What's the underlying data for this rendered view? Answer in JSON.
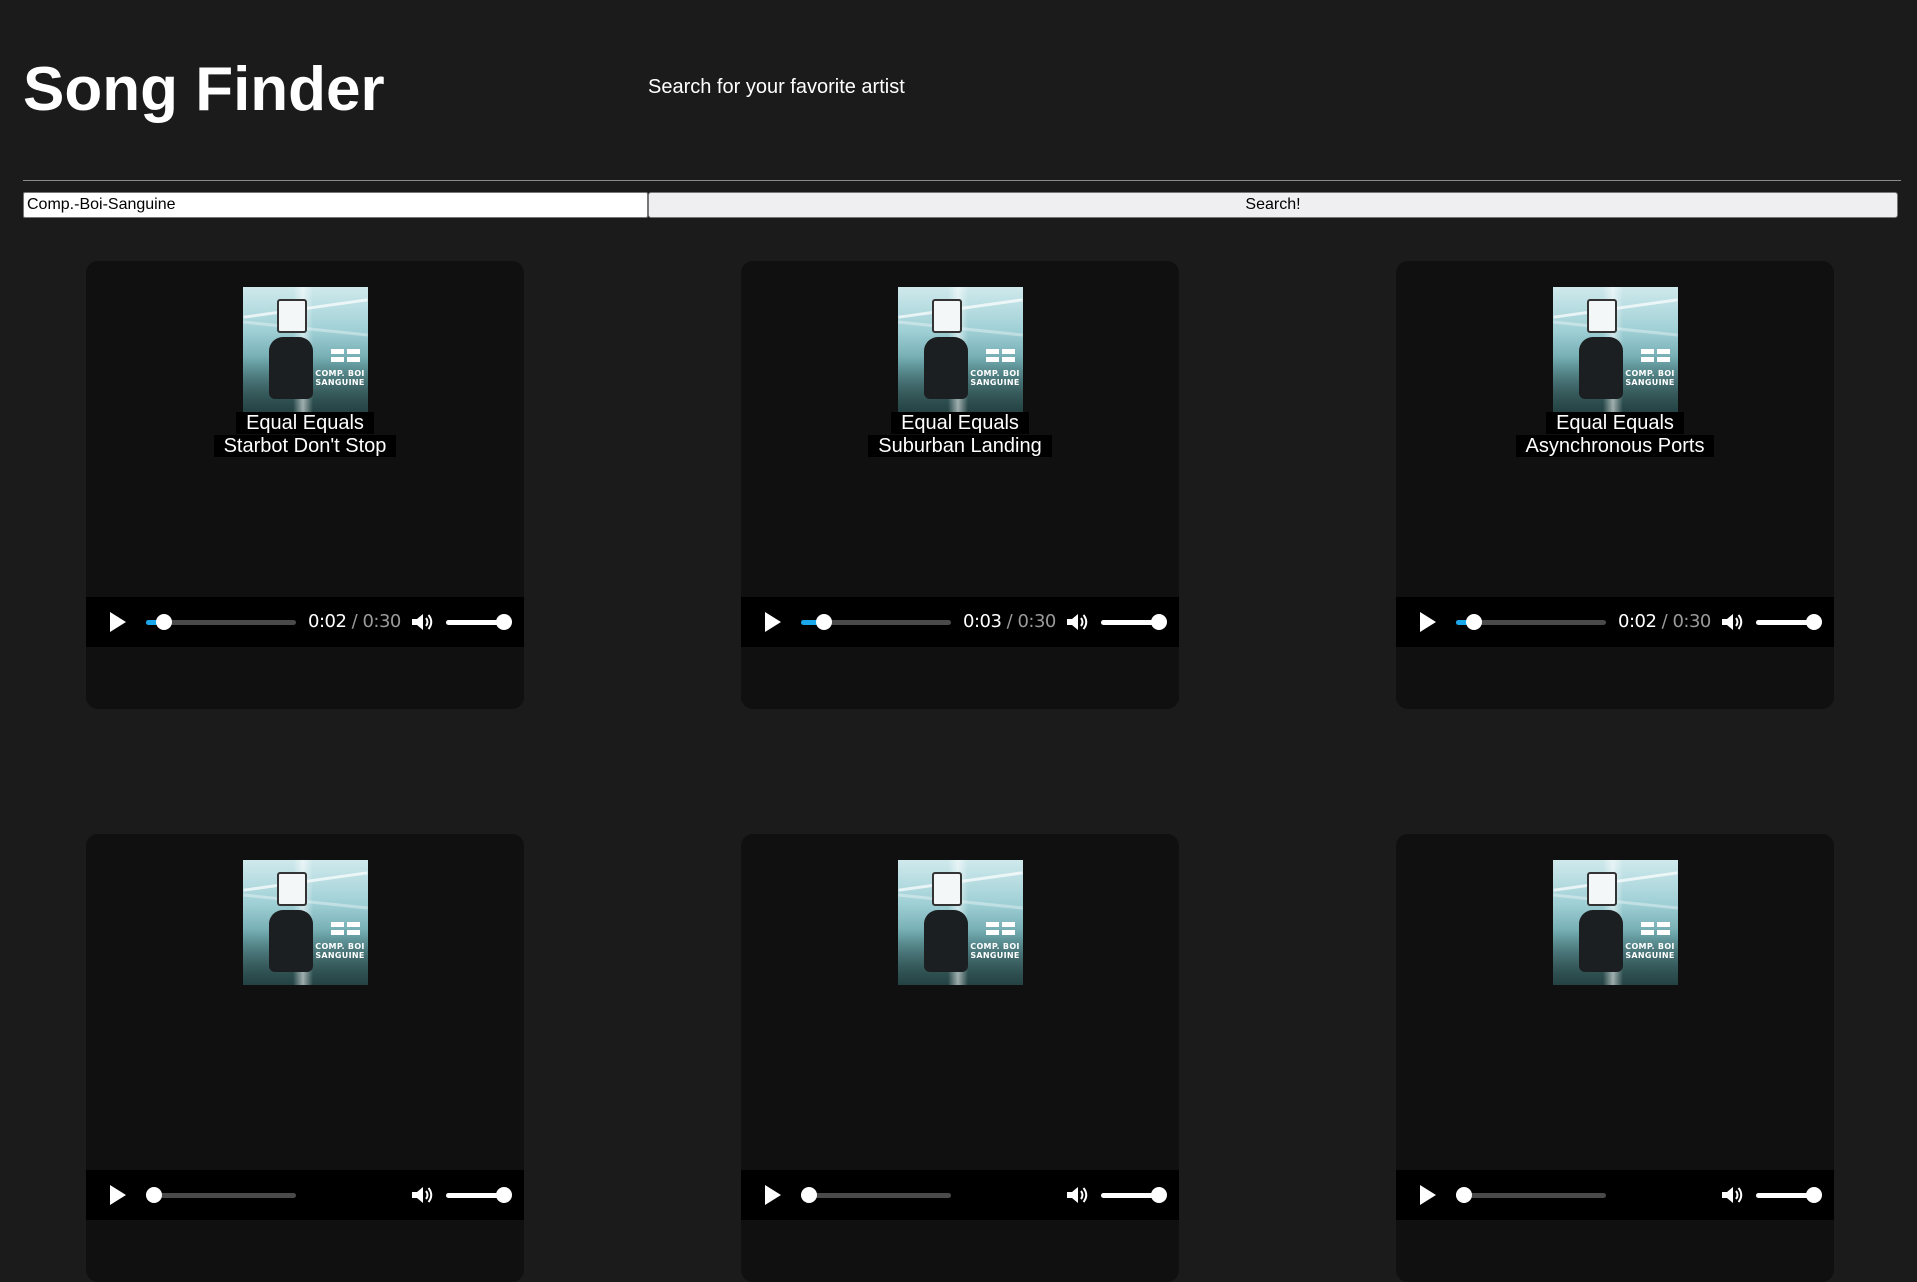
{
  "header": {
    "title": "Song Finder",
    "subtitle": "Search for your favorite artist"
  },
  "search": {
    "value": "Comp.-Boi-Sanguine",
    "button_label": "Search!"
  },
  "colors": {
    "background": "#1b1b1b",
    "card": "#101010",
    "progress_accent": "#1aa7ec"
  },
  "cover_art": {
    "icon": "album-cover-image",
    "text": "COMP. BOI SANGUINE"
  },
  "songs": [
    {
      "album": "Equal Equals",
      "title": "Starbot Don't Stop",
      "current_time": "0:02",
      "separator": "/",
      "duration": "0:30",
      "progress": 0.0667,
      "volume": 1.0
    },
    {
      "album": "Equal Equals",
      "title": "Suburban Landing",
      "current_time": "0:03",
      "separator": "/",
      "duration": "0:30",
      "progress": 0.1,
      "volume": 1.0
    },
    {
      "album": "Equal Equals",
      "title": "Asynchronous Ports",
      "current_time": "0:02",
      "separator": "/",
      "duration": "0:30",
      "progress": 0.0667,
      "volume": 1.0
    },
    {
      "album": "",
      "title": "",
      "current_time": "",
      "separator": "",
      "duration": "",
      "progress": 0,
      "volume": 1.0
    },
    {
      "album": "",
      "title": "",
      "current_time": "",
      "separator": "",
      "duration": "",
      "progress": 0,
      "volume": 1.0
    },
    {
      "album": "",
      "title": "",
      "current_time": "",
      "separator": "",
      "duration": "",
      "progress": 0,
      "volume": 1.0
    }
  ]
}
